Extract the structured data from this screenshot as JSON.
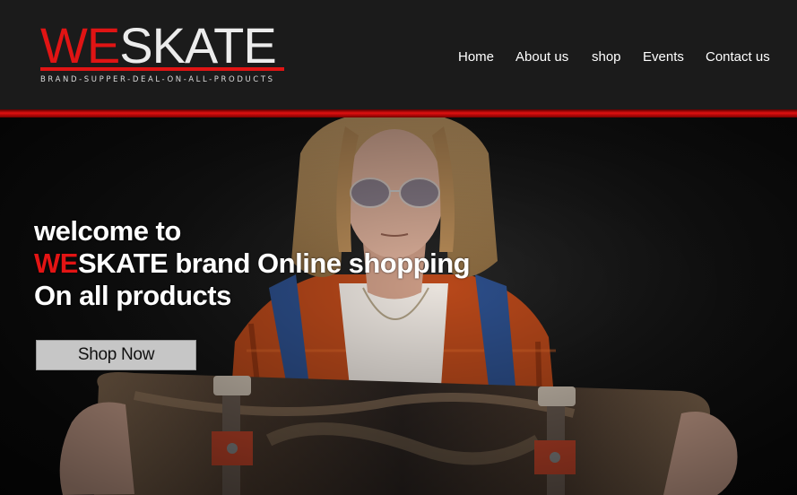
{
  "brand": {
    "logo_red": "WE",
    "logo_white": "SKATE",
    "tagline": "BRAND-SUPPER-DEAL-ON-ALL-PRODUCTS",
    "accent_color": "#e01414"
  },
  "nav": {
    "items": [
      {
        "label": "Home"
      },
      {
        "label": "About us"
      },
      {
        "label": "shop"
      },
      {
        "label": "Events"
      },
      {
        "label": "Contact us"
      }
    ]
  },
  "hero": {
    "line1": "welcome to",
    "line2_red": "WE",
    "line2_rest": "SKATE brand Online shopping",
    "line3": "On all products",
    "cta_label": "Shop Now",
    "image": "skater-holding-skateboard-photo"
  }
}
